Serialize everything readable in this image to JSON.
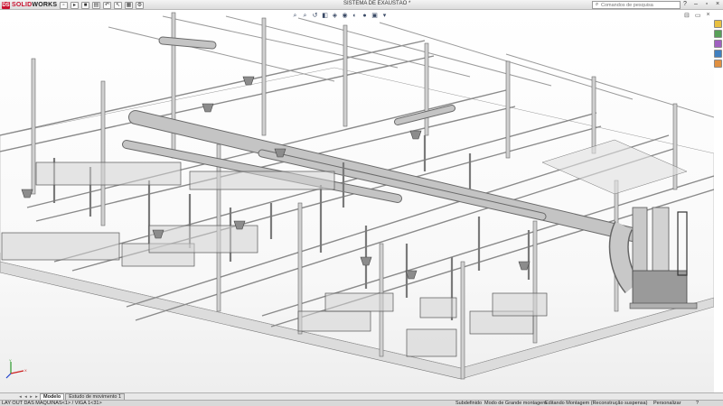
{
  "app": {
    "logo_brand": "SOLID",
    "logo_brand2": "WORKS",
    "logo_mark": "DS",
    "document_title": "SISTEMA DE EXAUSTÃO *",
    "search_placeholder": "Comandos de pesquisa"
  },
  "quick_access": [
    "new-icon",
    "open-icon",
    "save-icon",
    "print-icon",
    "undo-icon",
    "select-icon",
    "rebuild-icon",
    "options-icon"
  ],
  "heads_up": [
    "zoom-fit-icon",
    "zoom-area-icon",
    "previous-view-icon",
    "section-view-icon",
    "view-orientation-icon",
    "display-style-icon",
    "hide-show-icon",
    "appearance-icon",
    "scene-icon",
    "view-settings-icon"
  ],
  "tabs": {
    "model": "Modelo",
    "motion_study": "Estudo de movimento 1"
  },
  "status": {
    "left": "LAY OUT DAS MAQUINAS<1> / VIGA 1<31>",
    "underdefined": "Subdefinido",
    "large_assembly": "Modo de Grande montagem",
    "editing": "Editando Montagem (Reconstrução suspensa)",
    "customize": "Personalizar"
  },
  "colors": {
    "brand_red": "#c8102e",
    "steel": "#9a9a9a",
    "duct": "#b4b4b4",
    "taskpane": [
      "#e8c040",
      "#58a058",
      "#a060c0",
      "#4080c0",
      "#e09040"
    ]
  }
}
